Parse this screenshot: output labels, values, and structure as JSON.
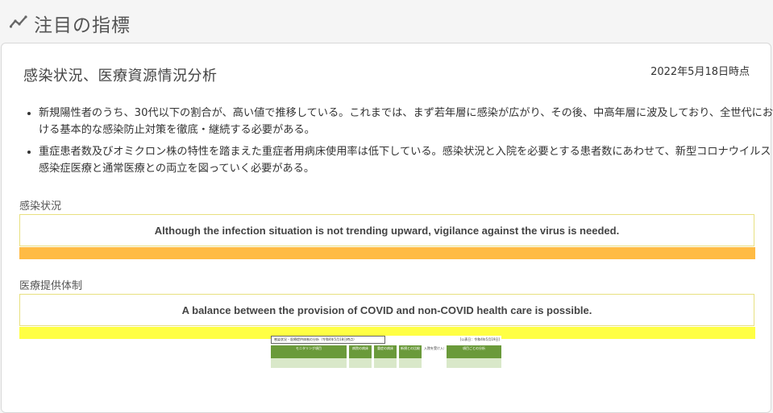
{
  "section": {
    "icon": "trend-line-icon",
    "title": "注目の指標"
  },
  "card": {
    "title": "感染状況、医療資源情況分析",
    "date": "2022年5月18日時点",
    "bullets": [
      "新規陽性者のうち、30代以下の割合が、高い値で推移している。これまでは、まず若年層に感染が広がり、その後、中高年層に波及しており、全世代における基本的な感染防止対策を徹底・継続する必要がある。",
      "重症患者数及びオミクロン株の特性を踏まえた重症者用病床使用率は低下している。感染状況と入院を必要とする患者数にあわせて、新型コロナウイルス感染症医療と通常医療との両立を図っていく必要がある。"
    ],
    "infection": {
      "label": "感染状況",
      "message": "Although the infection situation is not trending upward, vigilance against the virus is needed.",
      "color": "#ffbb44"
    },
    "medical": {
      "label": "医療提供体制",
      "message": "A balance between the provision of COVID and non-COVID health care is possible.",
      "color": "#ffff44"
    },
    "thumbnail": {
      "heading": "感染状況・医療提供体制の分析（令和4年5月18日時点）",
      "date": "[公表日：令和4年5月19日]",
      "cells": [
        "モニタリング項目",
        "病院の病床",
        "重症の病床",
        "新規との比較",
        "入院を受け入れ",
        "項目ごとの分析"
      ]
    }
  },
  "colors": {
    "trend_icon": "#666666",
    "thumb_green": "#6a9a3a"
  }
}
